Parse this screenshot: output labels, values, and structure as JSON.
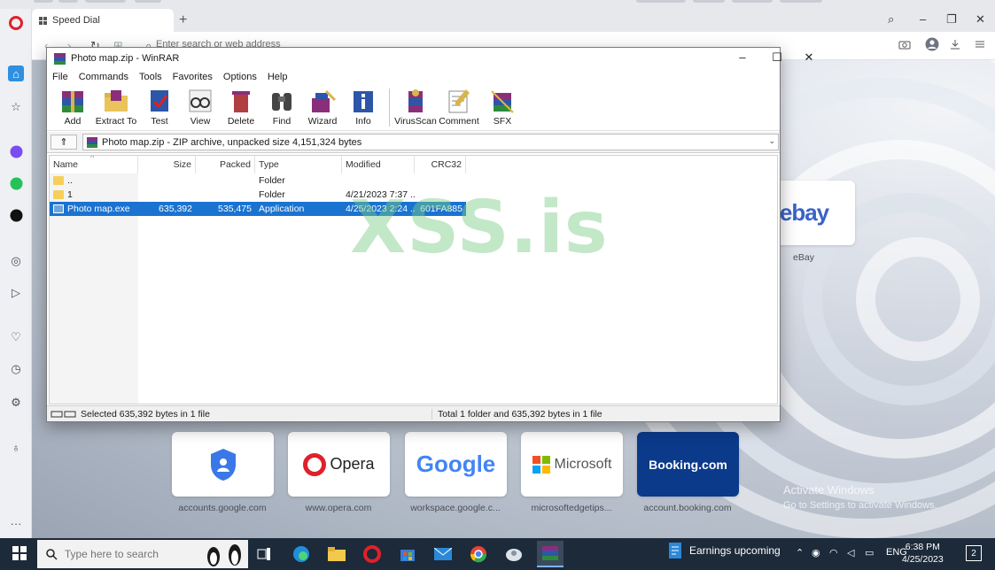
{
  "browser": {
    "tab_title": "Speed Dial",
    "new_tab": "+",
    "address_placeholder": "Enter search or web address",
    "minimize": "–",
    "maximize": "❐",
    "close": "✕",
    "back": "‹",
    "forward": "›",
    "reload": "↻",
    "grid": "⊞",
    "search_glyph": "⌕"
  },
  "speed_dial": [
    {
      "label": "accounts.google.com"
    },
    {
      "label": "www.opera.com",
      "logo": "Opera"
    },
    {
      "label": "workspace.google.c...",
      "logo": "Google"
    },
    {
      "label": "microsoftedgetips...",
      "logo": "Microsoft"
    },
    {
      "label": "account.booking.com",
      "logo": "Booking.com"
    },
    {
      "label": "eBay",
      "logo": "ebay"
    }
  ],
  "activate_windows": {
    "line1": "Activate Windows",
    "line2": "Go to Settings to activate Windows."
  },
  "winrar": {
    "title": "Photo map.zip - WinRAR",
    "menu": [
      "File",
      "Commands",
      "Tools",
      "Favorites",
      "Options",
      "Help"
    ],
    "toolbar": [
      "Add",
      "Extract To",
      "Test",
      "View",
      "Delete",
      "Find",
      "Wizard",
      "Info",
      "VirusScan",
      "Comment",
      "SFX"
    ],
    "path": "Photo map.zip - ZIP archive, unpacked size 4,151,324 bytes",
    "columns": [
      "Name",
      "Size",
      "Packed",
      "Type",
      "Modified",
      "CRC32"
    ],
    "rows": [
      {
        "name": "..",
        "size": "",
        "packed": "",
        "type": "Folder",
        "modified": "",
        "crc": ""
      },
      {
        "name": "1",
        "size": "",
        "packed": "",
        "type": "Folder",
        "modified": "4/21/2023 7:37 ...",
        "crc": ""
      },
      {
        "name": "Photo map.exe",
        "size": "635,392",
        "packed": "535,475",
        "type": "Application",
        "modified": "4/25/2023 2:24 ...",
        "crc": "601FA885"
      }
    ],
    "status_left": "Selected 635,392 bytes in 1 file",
    "status_right": "Total 1 folder and 635,392 bytes in 1 file",
    "sort_glyph": "^",
    "up_glyph": "⇑",
    "dropdown_glyph": "⌄",
    "min_glyph": "–",
    "max_glyph": "☐",
    "close_glyph": "✕"
  },
  "watermark": "XSS.is",
  "taskbar": {
    "search_placeholder": "Type here to search",
    "news": "Earnings upcoming",
    "lang": "ENG",
    "time": "6:38 PM",
    "date": "4/25/2023",
    "notifications": "2"
  },
  "colors": {
    "winrar_select": "#1a73d0",
    "taskbar": "#1c2a3a",
    "opera_red": "#e0202a",
    "booking": "#0b3a8a"
  }
}
